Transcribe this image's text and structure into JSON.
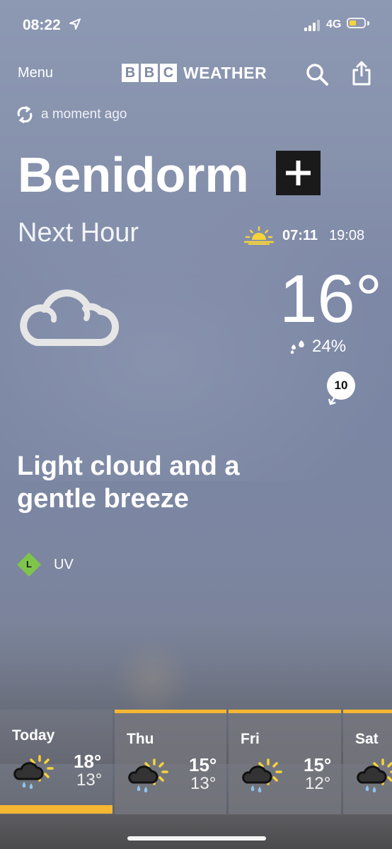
{
  "status_bar": {
    "time": "08:22",
    "network": "4G",
    "battery_level": 0.45,
    "battery_color": "#f6d33b"
  },
  "header": {
    "menu_label": "Menu",
    "logo_letters": [
      "B",
      "B",
      "C"
    ],
    "logo_word": "WEATHER",
    "search_icon": "search-icon",
    "share_icon": "share-icon"
  },
  "refresh": {
    "icon": "refresh-icon",
    "text": "a moment ago"
  },
  "location": {
    "name": "Benidorm",
    "add_icon": "plus-icon"
  },
  "current": {
    "period": "Next Hour",
    "sunrise": "07:11",
    "sunset": "19:08",
    "temperature": "16°",
    "precipitation": "24%",
    "wind_speed": "10",
    "icon": "light-cloud-icon",
    "summary": "Light cloud and a gentle breeze"
  },
  "uv": {
    "level": "L",
    "label": "UV",
    "color": "#7fc54a"
  },
  "forecast": [
    {
      "day": "Today",
      "high": "18°",
      "low": "13°",
      "icon": "light-rain-sun-icon",
      "selected": true
    },
    {
      "day": "Thu",
      "high": "15°",
      "low": "13°",
      "icon": "light-rain-sun-icon",
      "selected": false
    },
    {
      "day": "Fri",
      "high": "15°",
      "low": "12°",
      "icon": "light-rain-sun-icon",
      "selected": false
    },
    {
      "day": "Sat",
      "high": "",
      "low": "",
      "icon": "light-rain-sun-icon",
      "selected": false
    }
  ],
  "accent_color": "#f5b731"
}
